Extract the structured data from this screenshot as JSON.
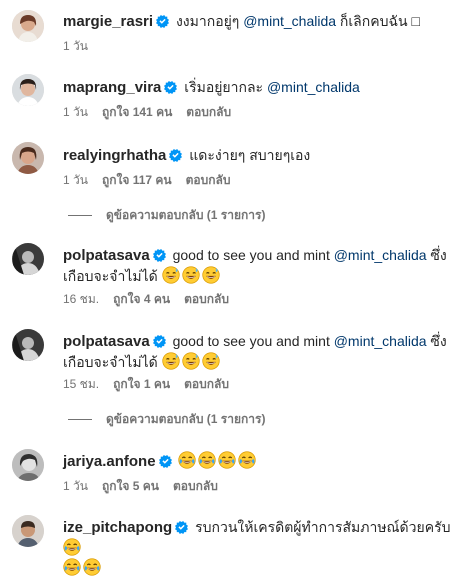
{
  "comments": [
    {
      "username": "margie_rasri",
      "text_before": "งงมากอยู่ๆ ",
      "mention": "@mint_chalida",
      "text_after": " ก็เลิกคบฉัน ",
      "emoji_tail": "□",
      "time": "1 วัน",
      "likes": "",
      "reply": ""
    },
    {
      "username": "maprang_vira",
      "text_before": "เริ่มอยู่ยากละ ",
      "mention": "@mint_chalida",
      "text_after": "",
      "time": "1 วัน",
      "likes": "ถูกใจ 141 คน",
      "reply": "ตอบกลับ"
    },
    {
      "username": "realyingrhatha",
      "text_before": "แดะง่ายๆ สบายๆเอง",
      "mention": "",
      "text_after": "",
      "time": "1 วัน",
      "likes": "ถูกใจ 117 คน",
      "reply": "ตอบกลับ"
    },
    {
      "username": "polpatasava",
      "text_before": "good to see you and mint ",
      "mention": "@mint_chalida",
      "text_after": " ซึ่ง",
      "line2": "เกือบจะจำไม่ได้ ",
      "time": "16 ชม.",
      "likes": "ถูกใจ 4 คน",
      "reply": "ตอบกลับ"
    },
    {
      "username": "polpatasava",
      "text_before": "good to see you and mint ",
      "mention": "@mint_chalida",
      "text_after": " ซึ่ง",
      "line2": "เกือบจะจำไม่ได้ ",
      "time": "15 ชม.",
      "likes": "ถูกใจ 1 คน",
      "reply": "ตอบกลับ"
    },
    {
      "username": "jariya.anfone",
      "text_before": "",
      "mention": "",
      "text_after": "",
      "time": "1 วัน",
      "likes": "ถูกใจ 5 คน",
      "reply": "ตอบกลับ"
    },
    {
      "username": "ize_pitchapong",
      "text_before": "รบกวนให้เครดิตผู้ทำการสัมภาษณ์ด้วยครับ",
      "mention": "",
      "text_after": "",
      "time": "",
      "likes": "",
      "reply": ""
    }
  ],
  "view_replies_1": "ดูข้อความตอบกลับ (1 รายการ)",
  "view_replies_2": "ดูข้อความตอบกลับ (1 รายการ)",
  "icons": {
    "verified": "verified-badge-icon",
    "sweat_emoji": "grinning-sweat-emoji",
    "tears_emoji": "crying-laughing-emoji"
  },
  "colors": {
    "verified": "#0095f6",
    "mention": "#00376b",
    "meta": "#737373",
    "text": "#262626"
  }
}
